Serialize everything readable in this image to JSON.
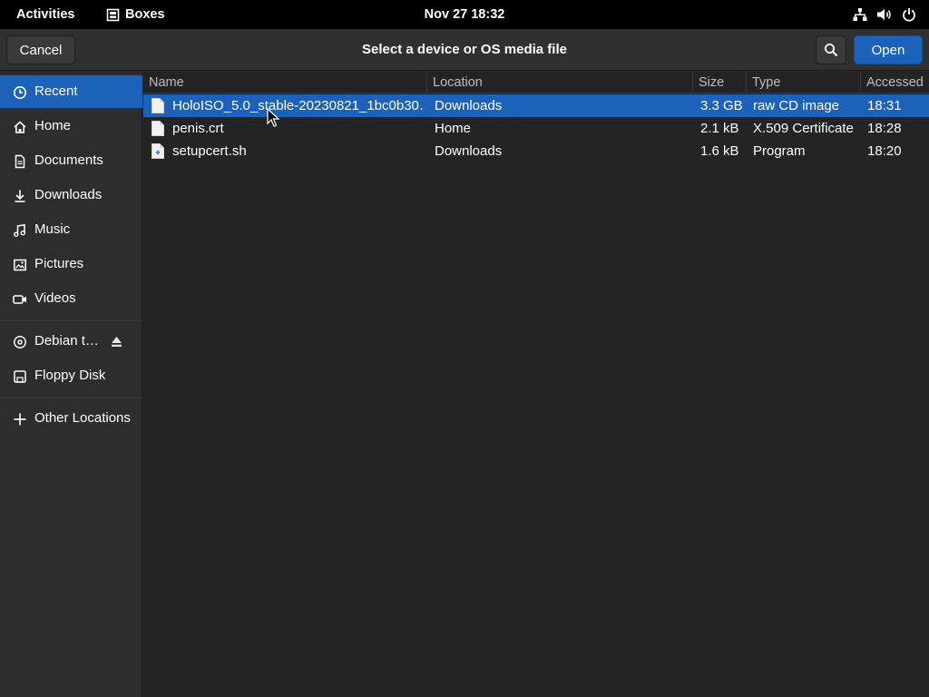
{
  "topbar": {
    "activities": "Activities",
    "app_name": "Boxes",
    "clock": "Nov 27  18:32",
    "status_icons": [
      "network-icon",
      "volume-icon",
      "power-icon"
    ]
  },
  "header": {
    "cancel_label": "Cancel",
    "title": "Select a device or OS media file",
    "open_label": "Open",
    "search_icon": "search-icon"
  },
  "sidebar": {
    "items": [
      {
        "label": "Recent",
        "icon": "clock-icon",
        "active": true
      },
      {
        "label": "Home",
        "icon": "home-icon"
      },
      {
        "label": "Documents",
        "icon": "document-icon"
      },
      {
        "label": "Downloads",
        "icon": "download-icon"
      },
      {
        "label": "Music",
        "icon": "music-icon"
      },
      {
        "label": "Pictures",
        "icon": "picture-icon"
      },
      {
        "label": "Videos",
        "icon": "video-icon"
      },
      {
        "label": "Debian t…",
        "icon": "disc-icon",
        "eject": true
      },
      {
        "label": "Floppy Disk",
        "icon": "floppy-icon"
      },
      {
        "label": "Other Locations",
        "icon": "plus-icon"
      }
    ]
  },
  "filelist": {
    "columns": {
      "name": "Name",
      "location": "Location",
      "size": "Size",
      "type": "Type",
      "accessed": "Accessed"
    },
    "rows": [
      {
        "name": "HoloISO_5.0_stable-20230821_1bc0b30…",
        "location": "Downloads",
        "size": "3.3 GB",
        "type": "raw CD image",
        "accessed": "18:31",
        "selected": true,
        "icon": "file-icon"
      },
      {
        "name": "penis.crt",
        "location": "Home",
        "size": "2.1 kB",
        "type": "X.509 Certificate",
        "accessed": "18:28",
        "icon": "file-icon"
      },
      {
        "name": "setupcert.sh",
        "location": "Downloads",
        "size": "1.6 kB",
        "type": "Program",
        "accessed": "18:20",
        "icon": "script-file-icon"
      }
    ]
  },
  "colors": {
    "accent": "#1c62b8",
    "topbar_bg": "#000000",
    "window_bg": "#242424",
    "sidebar_bg": "#2d2d2d",
    "headerbar_bg": "#303030"
  }
}
